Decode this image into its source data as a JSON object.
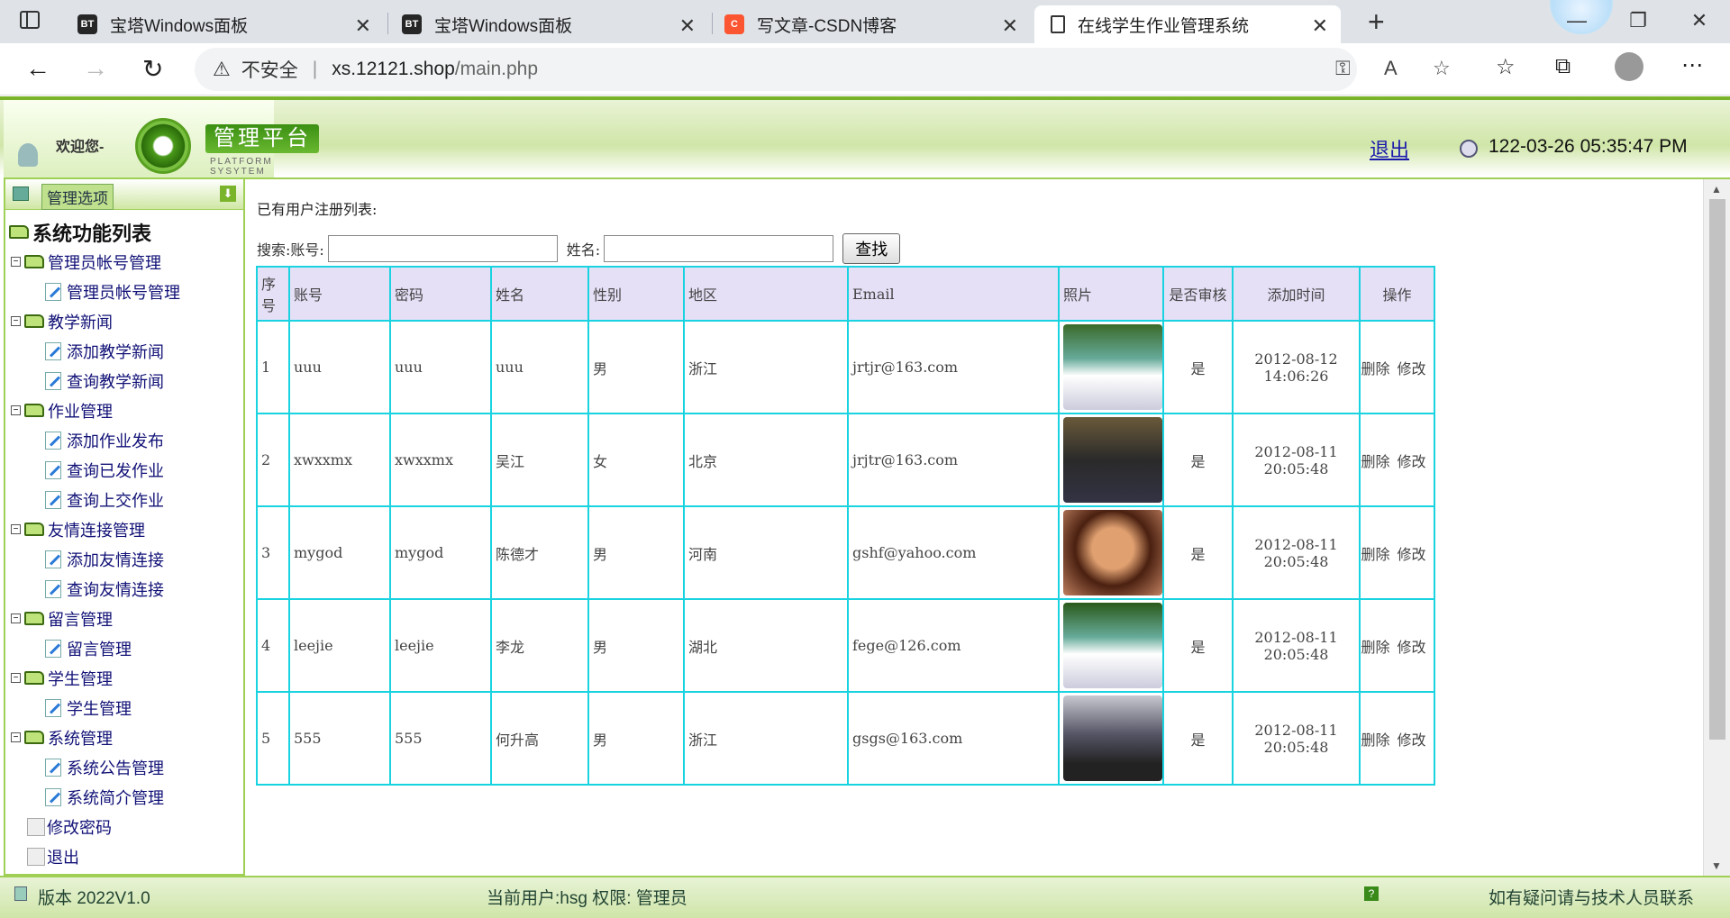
{
  "browser": {
    "tabs": [
      {
        "title": "宝塔Windows面板",
        "favicon": "BT"
      },
      {
        "title": "宝塔Windows面板",
        "favicon": "BT"
      },
      {
        "title": "写文章-CSDN博客",
        "favicon": "C"
      },
      {
        "title": "在线学生作业管理系统",
        "favicon": "page"
      }
    ],
    "security_label": "不安全",
    "url_host": "xs.12121.shop",
    "url_path": "/main.php"
  },
  "header": {
    "welcome": "欢迎您-",
    "platform_title": "管理平台",
    "platform_sub": "PLATFORM SYSYTEM",
    "logout": "退出",
    "datetime": "122-03-26 05:35:47 PM"
  },
  "sidebar": {
    "header_label": "管理选项",
    "root": "系统功能列表",
    "groups": [
      {
        "label": "管理员帐号管理",
        "items": [
          "管理员帐号管理"
        ]
      },
      {
        "label": "教学新闻",
        "items": [
          "添加教学新闻",
          "查询教学新闻"
        ]
      },
      {
        "label": "作业管理",
        "items": [
          "添加作业发布",
          "查询已发作业",
          "查询上交作业"
        ]
      },
      {
        "label": "友情连接管理",
        "items": [
          "添加友情连接",
          "查询友情连接"
        ]
      },
      {
        "label": "留言管理",
        "items": [
          "留言管理"
        ]
      },
      {
        "label": "学生管理",
        "items": [
          "学生管理"
        ]
      },
      {
        "label": "系统管理",
        "items": [
          "系统公告管理",
          "系统简介管理"
        ]
      }
    ],
    "leaves": [
      "修改密码",
      "退出"
    ]
  },
  "main": {
    "list_title": "已有用户注册列表:",
    "search_label": "搜索:账号:",
    "name_label": "姓名:",
    "search_button": "查找",
    "columns": [
      "序号",
      "账号",
      "密码",
      "姓名",
      "性别",
      "地区",
      "Email",
      "照片",
      "是否审核",
      "添加时间",
      "操作"
    ],
    "rows": [
      {
        "no": "1",
        "account": "uuu",
        "password": "uuu",
        "name": "uuu",
        "gender": "男",
        "region": "浙江",
        "email": "jrtjr@163.com",
        "approved": "是",
        "date": "2012-08-12",
        "time": "14:06:26"
      },
      {
        "no": "2",
        "account": "xwxxmx",
        "password": "xwxxmx",
        "name": "吴江",
        "gender": "女",
        "region": "北京",
        "email": "jrjtr@163.com",
        "approved": "是",
        "date": "2012-08-11",
        "time": "20:05:48"
      },
      {
        "no": "3",
        "account": "mygod",
        "password": "mygod",
        "name": "陈德才",
        "gender": "男",
        "region": "河南",
        "email": "gshf@yahoo.com",
        "approved": "是",
        "date": "2012-08-11",
        "time": "20:05:48"
      },
      {
        "no": "4",
        "account": "leejie",
        "password": "leejie",
        "name": "李龙",
        "gender": "男",
        "region": "湖北",
        "email": "fege@126.com",
        "approved": "是",
        "date": "2012-08-11",
        "time": "20:05:48"
      },
      {
        "no": "5",
        "account": "555",
        "password": "555",
        "name": "何升高",
        "gender": "男",
        "region": "浙江",
        "email": "gsgs@163.com",
        "approved": "是",
        "date": "2012-08-11",
        "time": "20:05:48"
      }
    ],
    "op_delete": "删除",
    "op_edit": "修改"
  },
  "footer": {
    "version": "版本 2022V1.0",
    "current_user": "当前用户:hsg 权限: 管理员",
    "help": "如有疑问请与技术人员联系"
  },
  "colors": {
    "accent": "#7ab42a",
    "table_border": "#19d3e0",
    "table_header": "#e6e0f7"
  }
}
